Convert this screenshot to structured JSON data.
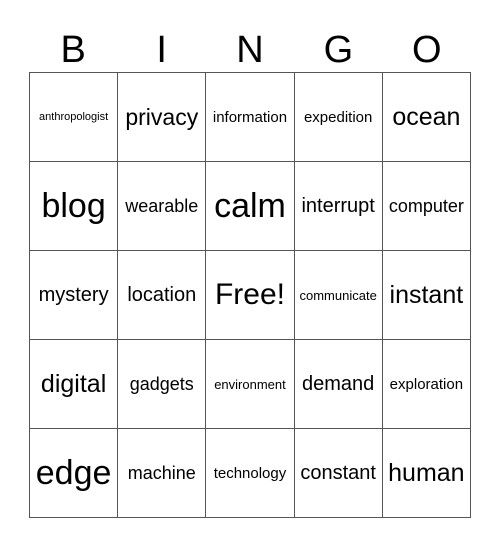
{
  "title_letters": [
    "B",
    "I",
    "N",
    "G",
    "O"
  ],
  "rows": [
    [
      "anthropologist",
      "privacy",
      "information",
      "expedition",
      "ocean"
    ],
    [
      "blog",
      "wearable",
      "calm",
      "interrupt",
      "computer"
    ],
    [
      "mystery",
      "location",
      "Free!",
      "communicate",
      "instant"
    ],
    [
      "digital",
      "gadgets",
      "environment",
      "demand",
      "exploration"
    ],
    [
      "edge",
      "machine",
      "technology",
      "constant",
      "human"
    ]
  ],
  "free_space_label": "Free!"
}
